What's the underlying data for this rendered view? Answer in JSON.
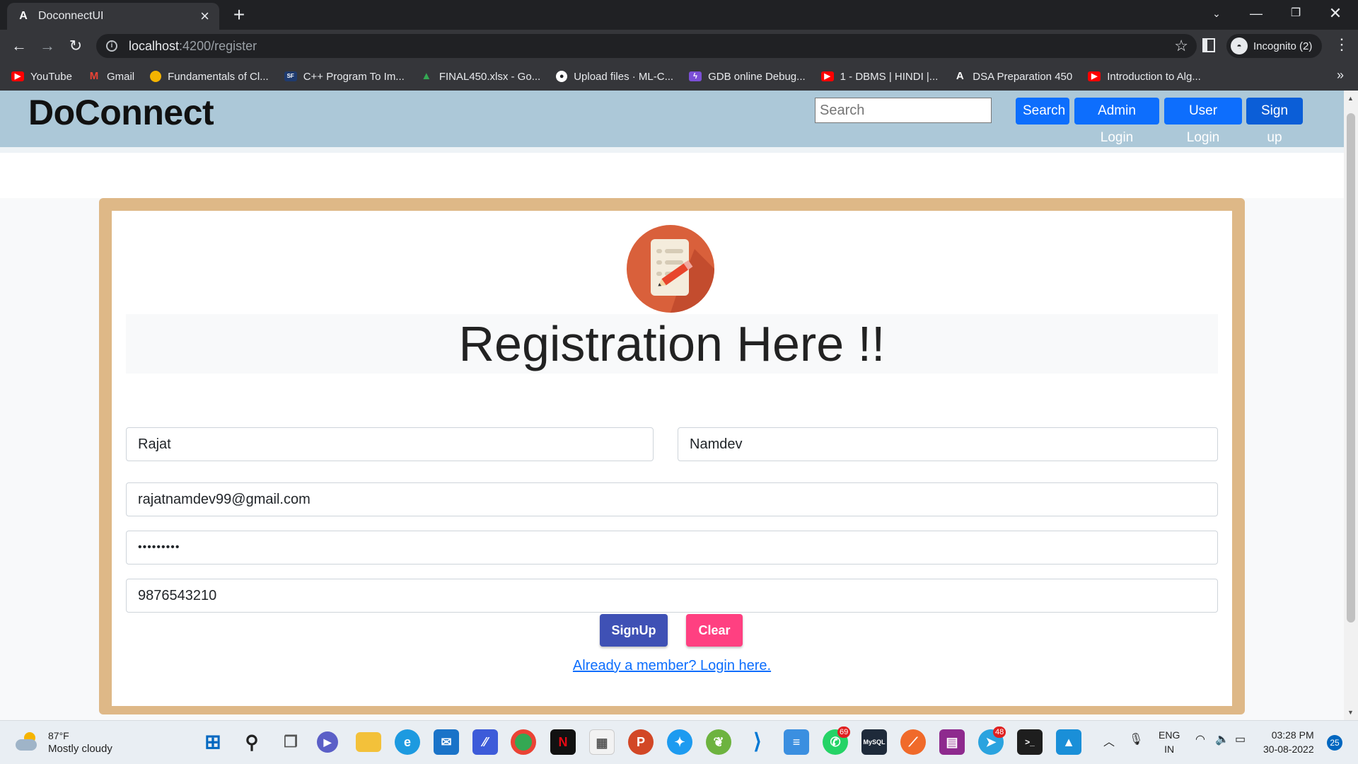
{
  "browser": {
    "tab_title": "DoconnectUI",
    "tab_favicon": "A",
    "url_host": "localhost",
    "url_path": ":4200/register",
    "incognito_label": "Incognito (2)",
    "bookmarks": [
      {
        "label": "YouTube",
        "icon": "youtube-icon",
        "color": "#ff0000"
      },
      {
        "label": "Gmail",
        "icon": "gmail-icon",
        "color": "#ea4335"
      },
      {
        "label": "Fundamentals of Cl...",
        "icon": "coin-icon",
        "color": "#f5b400"
      },
      {
        "label": "C++ Program To Im...",
        "icon": "gfg-icon",
        "color": "#1f3b6e"
      },
      {
        "label": "FINAL450.xlsx - Go...",
        "icon": "drive-icon",
        "color": "#34a853"
      },
      {
        "label": "Upload files · ML-C...",
        "icon": "github-icon",
        "color": "#ffffff"
      },
      {
        "label": "GDB online Debug...",
        "icon": "bolt-icon",
        "color": "#7b4fd6"
      },
      {
        "label": "1 - DBMS | HINDI |...",
        "icon": "youtube-icon",
        "color": "#ff0000"
      },
      {
        "label": "DSA Preparation 450",
        "icon": "angular-icon",
        "color": "#ffffff"
      },
      {
        "label": "Introduction to Alg...",
        "icon": "youtube-icon",
        "color": "#ff0000"
      }
    ]
  },
  "navbar": {
    "brand": "DoConnect",
    "search_placeholder": "Search",
    "search_button": "Search",
    "admin_login": "Admin Login",
    "user_login": "User Login",
    "sign_up": "Sign up",
    "background": "#acc8d8"
  },
  "form": {
    "heading": "Registration Here !!",
    "first_name": "Rajat",
    "last_name": "Namdev",
    "email": "rajatnamdev99@gmail.com",
    "password_mask": "•••••••••",
    "phone": "9876543210",
    "signup_label": "SignUp",
    "clear_label": "Clear",
    "login_link": "Already a member? Login here.",
    "card_border_color": "#deb887",
    "signup_color": "#3f51b5",
    "clear_color": "#ff4081"
  },
  "taskbar": {
    "temperature": "87°F",
    "condition": "Mostly cloudy",
    "lang_line1": "ENG",
    "lang_line2": "IN",
    "time": "03:28 PM",
    "date": "30-08-2022",
    "notification_count": "25",
    "whatsapp_badge": "69",
    "telegram_badge": "48"
  }
}
